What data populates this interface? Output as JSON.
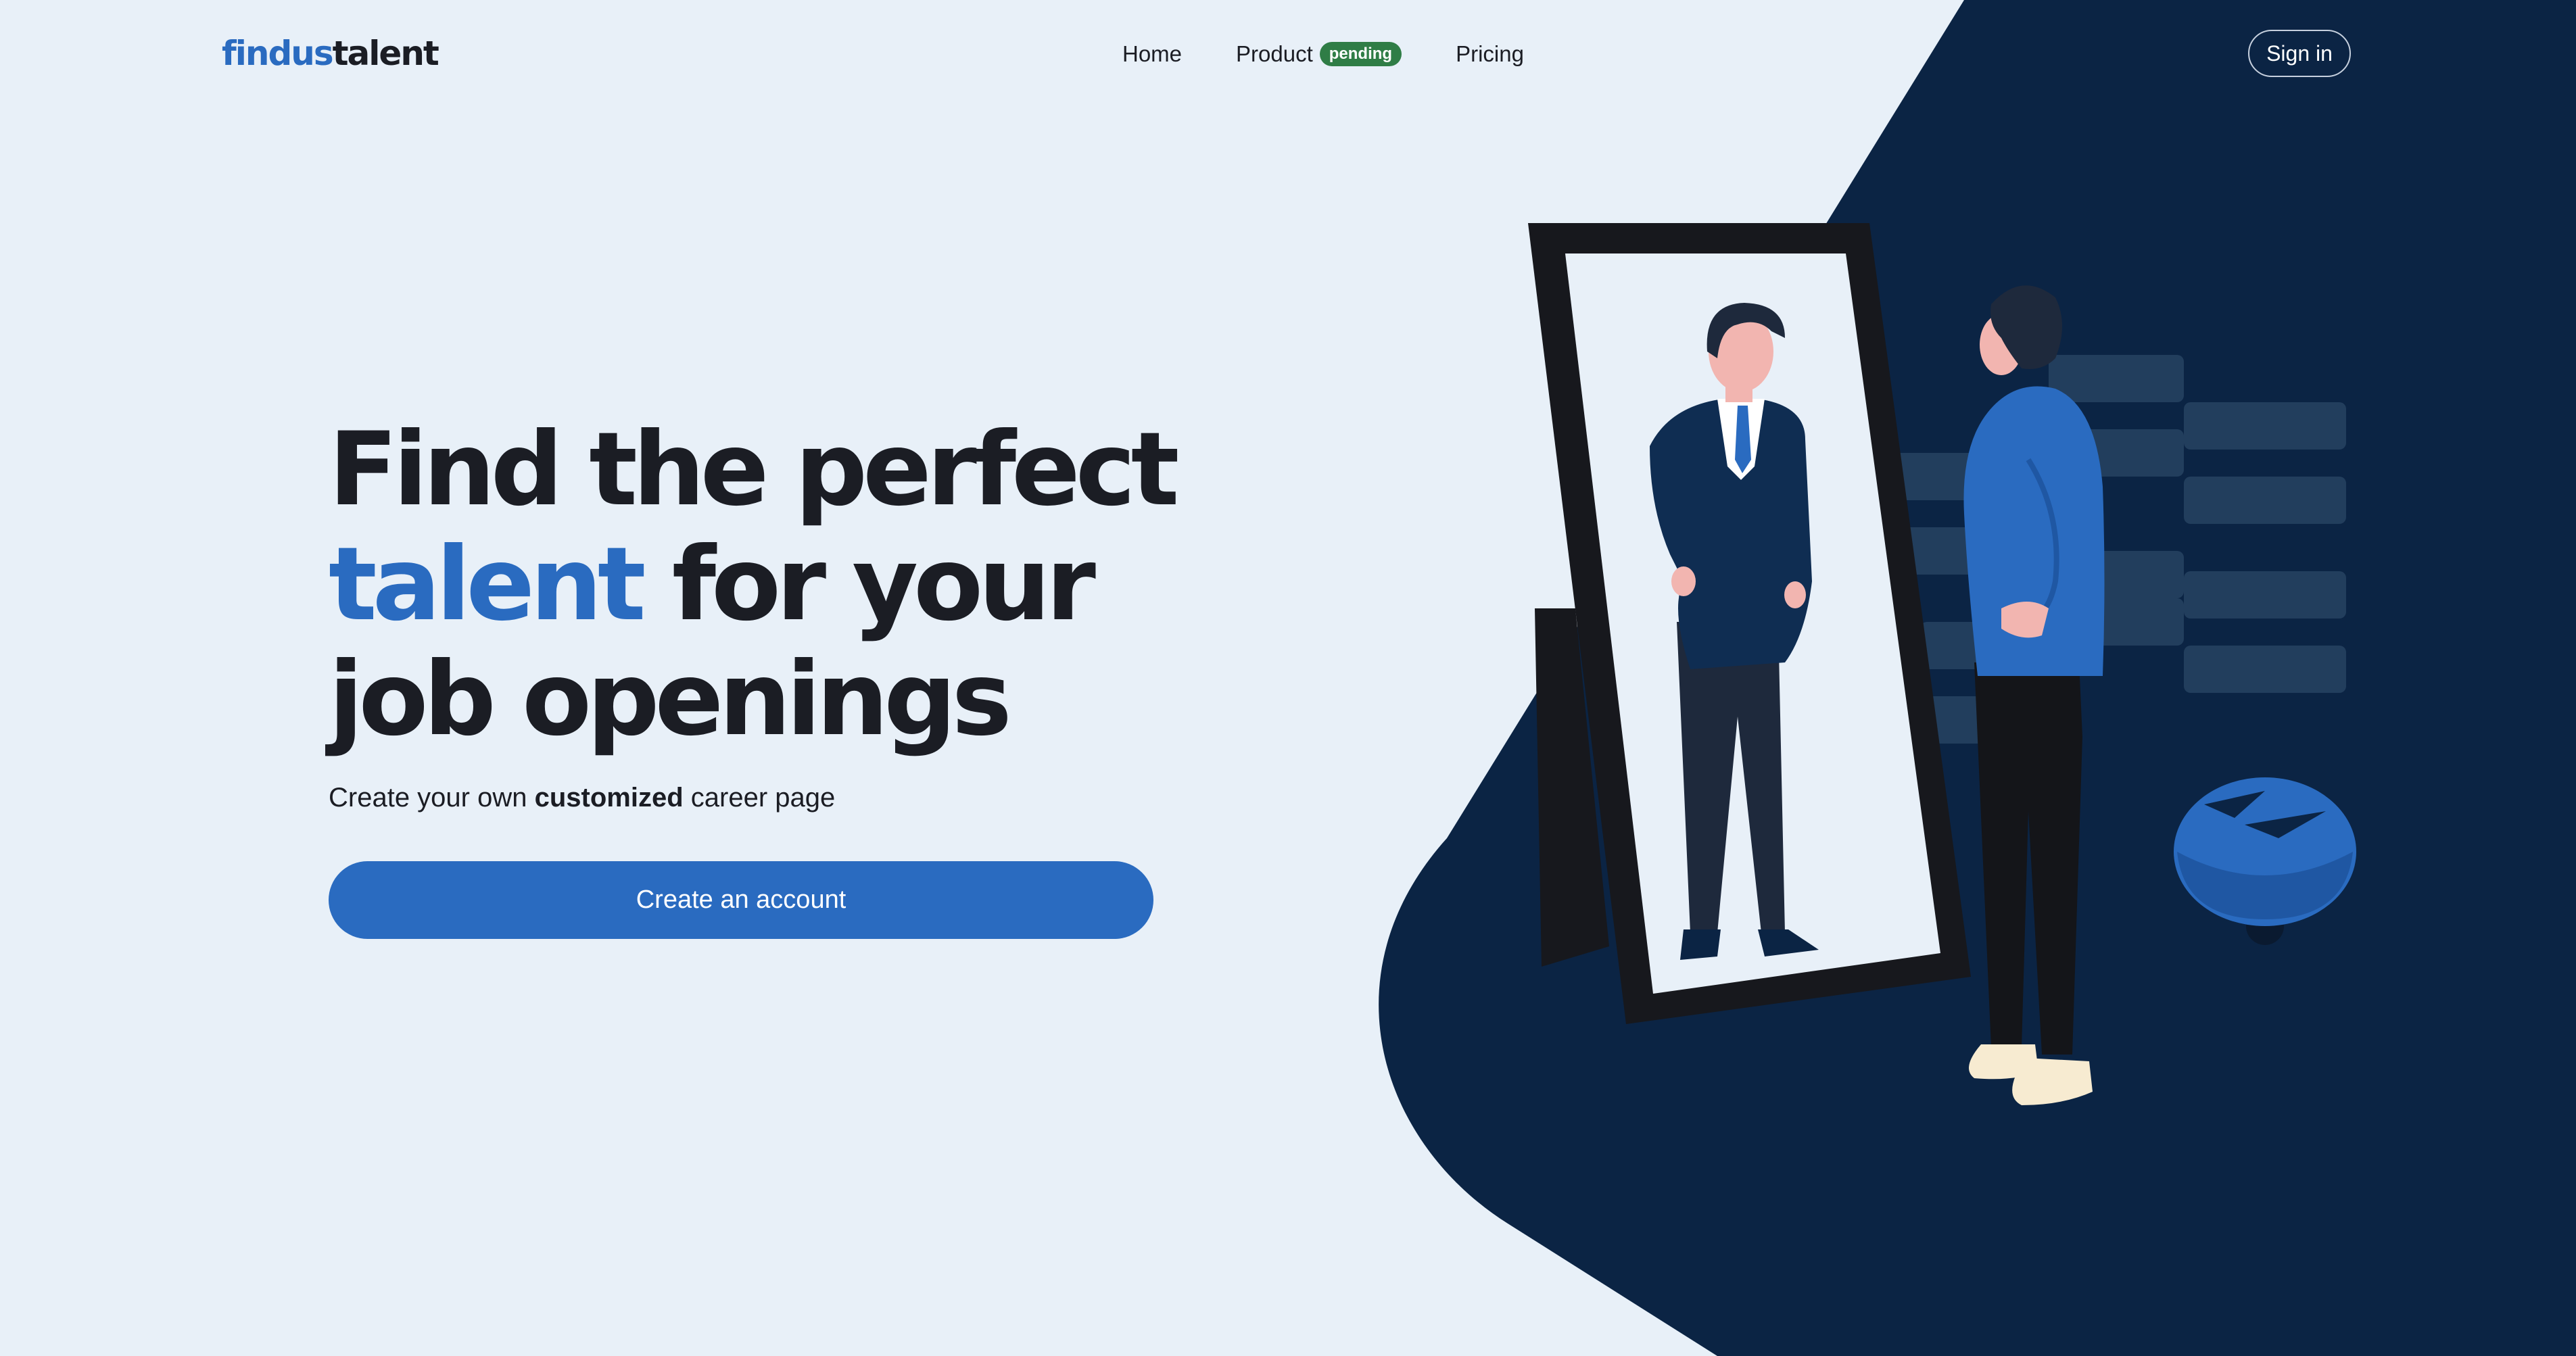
{
  "header": {
    "logo": {
      "part1": "findus",
      "part2": "talent"
    },
    "nav": [
      {
        "label": "Home"
      },
      {
        "label": "Product",
        "badge": "pending"
      },
      {
        "label": "Pricing"
      }
    ],
    "signin_label": "Sign in"
  },
  "hero": {
    "title_line1": "Find the perfect",
    "title_accent": "talent",
    "title_line2_rest": " for your",
    "title_line3": "job openings",
    "subtitle_pre": "Create your own ",
    "subtitle_bold": "customized",
    "subtitle_post": " career page",
    "cta_label": "Create an account"
  },
  "colors": {
    "background": "#e8f0f8",
    "dark_panel": "#0b2444",
    "accent": "#2a6bc0",
    "text": "#1b1d24",
    "badge": "#2f7d46"
  },
  "icons": {
    "illustration": "man-looking-in-mirror-illustration"
  }
}
